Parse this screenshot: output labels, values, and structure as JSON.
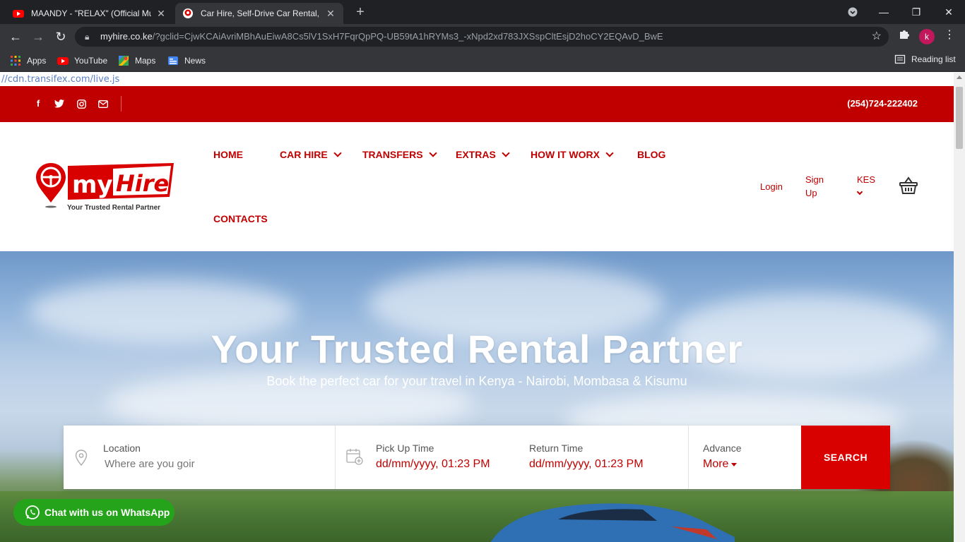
{
  "browser": {
    "tabs": [
      {
        "title": "MAANDY - \"RELAX\" (Official Mus",
        "close": "✕"
      },
      {
        "title": "Car Hire, Self-Drive Car Rental, Ai",
        "close": "✕"
      }
    ],
    "new_tab": "+",
    "address": {
      "host": "myhire.co.ke",
      "path": "/?gclid=CjwKCAiAvriMBhAuEiwA8Cs5lV1SxH7FqrQpPQ-UB59tA1hRYMs3_-xNpd2xd783JXSspCltEsjD2hoCY2EQAvD_BwE"
    },
    "profile_initial": "k",
    "bookmarks": [
      {
        "label": "Apps",
        "icon": "apps-grid-icon"
      },
      {
        "label": "YouTube",
        "icon": "youtube-icon"
      },
      {
        "label": "Maps",
        "icon": "maps-icon"
      },
      {
        "label": "News",
        "icon": "news-icon"
      }
    ],
    "reading_list": "Reading list"
  },
  "page": {
    "cdn_text": "//cdn.transifex.com/live.js",
    "topbar": {
      "phone": "(254)724-222402",
      "social": [
        "facebook-icon",
        "twitter-icon",
        "instagram-icon",
        "email-icon"
      ]
    },
    "logo": {
      "brand_my": "my",
      "brand_hire": "Hire",
      "tagline": "Your Trusted Rental Partner"
    },
    "nav": [
      {
        "label": "HOME",
        "dropdown": false
      },
      {
        "label": "CAR HIRE",
        "dropdown": true
      },
      {
        "label": "TRANSFERS",
        "dropdown": true
      },
      {
        "label": "EXTRAS",
        "dropdown": true
      },
      {
        "label": "HOW IT WORX",
        "dropdown": true
      },
      {
        "label": "BLOG",
        "dropdown": false
      },
      {
        "label": "CONTACTS",
        "dropdown": false
      }
    ],
    "account": {
      "login": "Login",
      "sign": "Sign",
      "up": "Up",
      "currency": "KES"
    },
    "hero": {
      "title": "Your Trusted Rental Partner",
      "subtitle": "Book the perfect car for your travel in Kenya - Nairobi, Mombasa & Kisumu"
    },
    "search": {
      "location_label": "Location",
      "location_placeholder": "Where are you goir",
      "pickup_label": "Pick Up Time",
      "pickup_value": "dd/mm/yyyy, 01:23 PM",
      "return_label": "Return Time",
      "return_value": "dd/mm/yyyy, 01:23 PM",
      "advance_label": "Advance",
      "more_label": "More",
      "button": "SEARCH"
    },
    "whatsapp": "Chat with us on WhatsApp"
  },
  "colors": {
    "brand_red": "#c00000",
    "search_red": "#d90000",
    "whatsapp_green": "#25a31a"
  }
}
